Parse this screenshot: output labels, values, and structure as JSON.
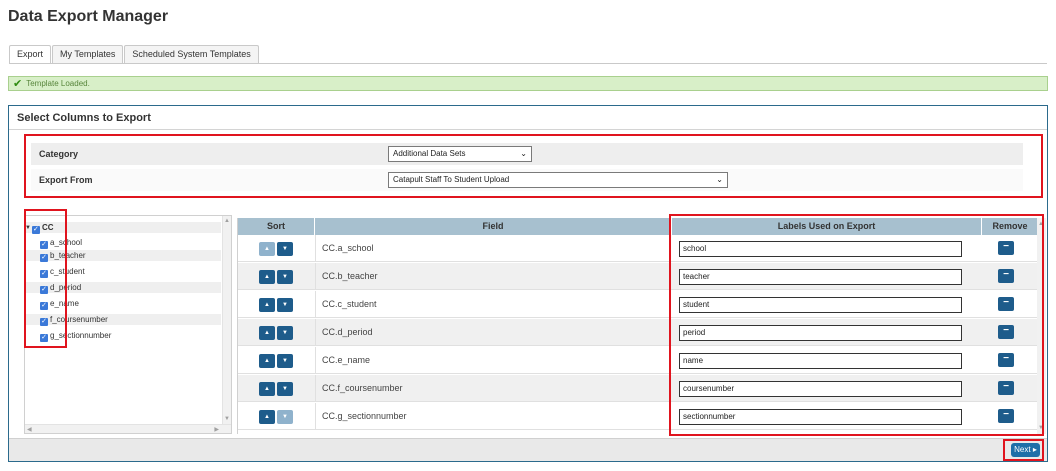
{
  "page": {
    "title": "Data Export Manager"
  },
  "tabs": [
    {
      "label": "Export",
      "active": true
    },
    {
      "label": "My Templates",
      "active": false
    },
    {
      "label": "Scheduled System Templates",
      "active": false
    }
  ],
  "status": {
    "icon": "check-icon",
    "text": "Template Loaded."
  },
  "panel": {
    "title": "Select Columns to Export"
  },
  "selectors": {
    "category": {
      "label": "Category",
      "value": "Additional Data Sets"
    },
    "export_from": {
      "label": "Export From",
      "value": "Catapult Staff To Student Upload"
    }
  },
  "tree": {
    "root": "CC",
    "items": [
      "a_school",
      "b_teacher",
      "c_student",
      "d_period",
      "e_name",
      "f_coursenumber",
      "g_sectionnumber"
    ]
  },
  "grid": {
    "headers": {
      "sort": "Sort",
      "field": "Field",
      "labels": "Labels Used on Export",
      "remove": "Remove"
    },
    "rows": [
      {
        "field": "CC.a_school",
        "label": "school"
      },
      {
        "field": "CC.b_teacher",
        "label": "teacher"
      },
      {
        "field": "CC.c_student",
        "label": "student"
      },
      {
        "field": "CC.d_period",
        "label": "period"
      },
      {
        "field": "CC.e_name",
        "label": "name"
      },
      {
        "field": "CC.f_coursenumber",
        "label": "coursenumber"
      },
      {
        "field": "CC.g_sectionnumber",
        "label": "sectionnumber"
      }
    ]
  },
  "footer": {
    "next_label": "Next"
  },
  "colors": {
    "accent": "#1e5c8b",
    "highlight": "#e0141e",
    "success": "#d8efc8"
  }
}
